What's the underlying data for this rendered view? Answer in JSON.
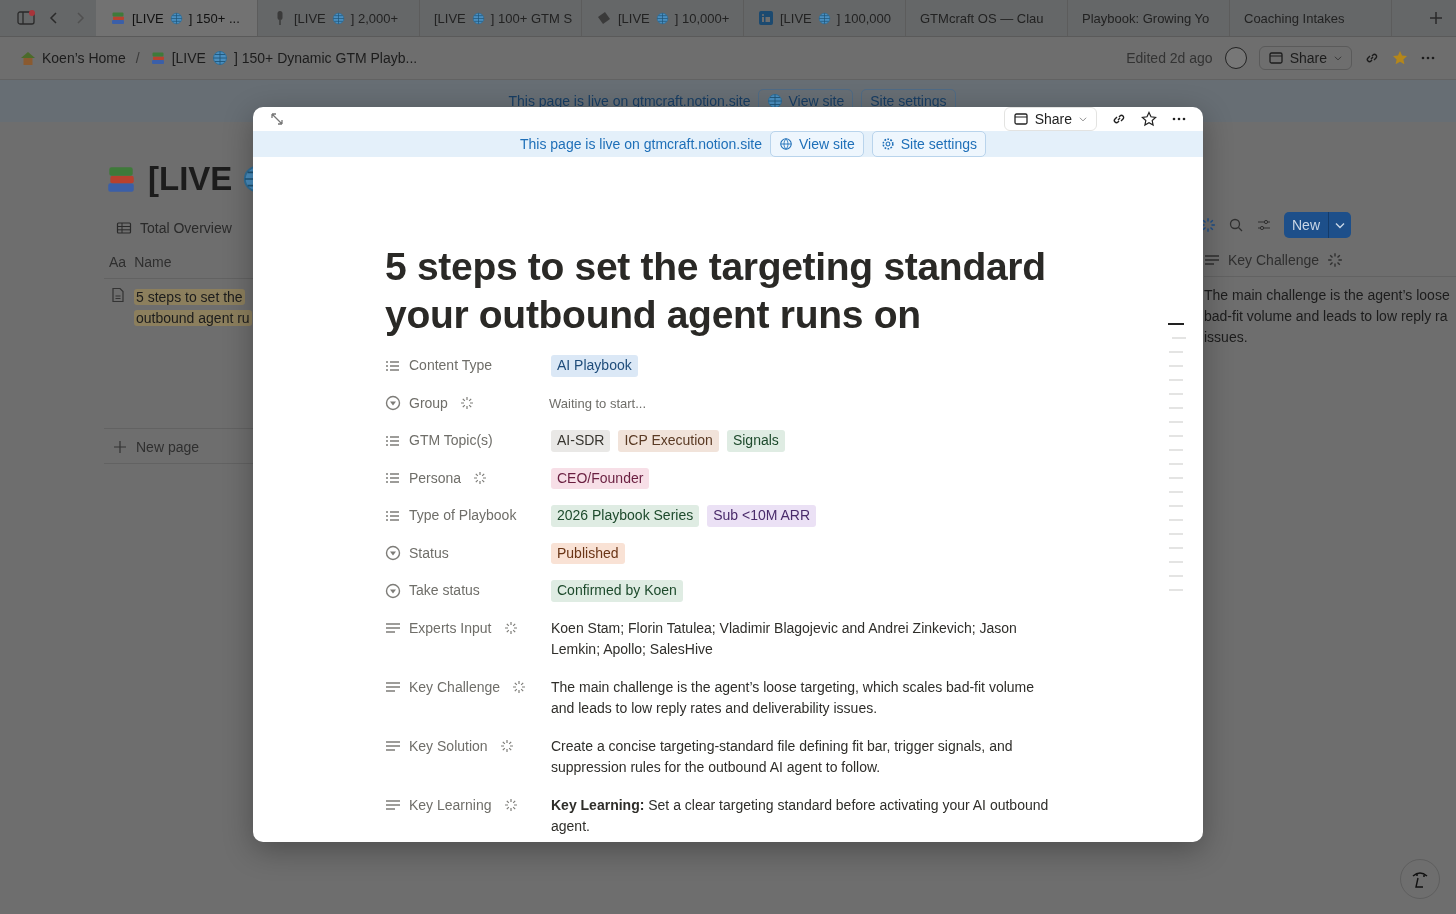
{
  "browser_tabs": [
    {
      "kind": "live",
      "prefix": "[LIVE",
      "suffix": "] 150+ ...",
      "selected": true
    },
    {
      "kind": "live",
      "prefix": "[LIVE",
      "suffix": "] 2,000+",
      "selected": false
    },
    {
      "kind": "live",
      "prefix": "[LIVE",
      "suffix": "] 100+ GTM S",
      "selected": false
    },
    {
      "kind": "live",
      "prefix": "[LIVE",
      "suffix": "] 10,000+",
      "selected": false
    },
    {
      "kind": "live",
      "prefix": "[LIVE",
      "suffix": "] 100,000",
      "selected": false
    },
    {
      "kind": "plain",
      "label": "GTMcraft OS — Clau",
      "selected": false
    },
    {
      "kind": "plain",
      "label": "Playbook: Growing Yo",
      "selected": false
    },
    {
      "kind": "plain",
      "label": "Coaching Intakes",
      "selected": false
    }
  ],
  "breadcrumb": {
    "home": "Koen’s Home",
    "separator": "/",
    "page_prefix": "[LIVE",
    "page_suffix": "] 150+ Dynamic GTM Playb...",
    "edited": "Edited 2d ago",
    "share": "Share"
  },
  "back_banner": {
    "text": "This page is live on gtmcraft.notion.site",
    "view": "View site",
    "settings": "Site settings"
  },
  "database": {
    "title": "[LIVE",
    "view": "Total Overview",
    "name_icon": "Aa",
    "name_header": "Name",
    "row_lines": [
      "5 steps to set the",
      "outbound agent ru"
    ],
    "new_page": "New page",
    "new_button": "New",
    "column_header": "Key Challenge",
    "column_lines": [
      "The main challenge is the agent’s loose",
      "bad-fit volume and leads to low reply ra",
      "issues."
    ]
  },
  "modal": {
    "share": "Share",
    "banner": {
      "text": "This page is live on gtmcraft.notion.site",
      "view": "View site",
      "settings": "Site settings"
    },
    "title": "5 steps to set the targeting standard your outbound agent runs on",
    "properties": [
      {
        "kind": "multi_select",
        "label": "Content Type",
        "ai": false,
        "tags": [
          {
            "text": "AI Playbook",
            "color": "#dbe8f6"
          }
        ]
      },
      {
        "kind": "select",
        "label": "Group",
        "ai": true,
        "placeholder": "Waiting to start..."
      },
      {
        "kind": "multi_select",
        "label": "GTM Topic(s)",
        "ai": false,
        "tags": [
          {
            "text": "AI-SDR",
            "color": "#e9e8e6"
          },
          {
            "text": "ICP Execution",
            "color": "#f1e3da"
          },
          {
            "text": "Signals",
            "color": "#dfece3"
          }
        ]
      },
      {
        "kind": "multi_select",
        "label": "Persona",
        "ai": true,
        "tags": [
          {
            "text": "CEO/Founder",
            "color": "#f7dfe7"
          }
        ]
      },
      {
        "kind": "multi_select",
        "label": "Type of Playbook",
        "ai": false,
        "tags": [
          {
            "text": "2026 Playbook Series",
            "color": "#dfece3"
          },
          {
            "text": "Sub <10M ARR",
            "color": "#ebe1f5"
          }
        ]
      },
      {
        "kind": "select",
        "label": "Status",
        "ai": false,
        "tags": [
          {
            "text": "Published",
            "color": "#f9e2d5"
          }
        ]
      },
      {
        "kind": "select",
        "label": "Take status",
        "ai": false,
        "tags": [
          {
            "text": "Confirmed by Koen",
            "color": "#dfece3"
          }
        ]
      },
      {
        "kind": "text",
        "label": "Experts Input",
        "ai": true,
        "text": "Koen Stam; Florin Tatulea; Vladimir Blagojevic and Andrei Zinkevich; Jason Lemkin; Apollo; SalesHive"
      },
      {
        "kind": "text",
        "label": "Key Challenge",
        "ai": true,
        "text": "The main challenge is the agent’s loose targeting, which scales bad-fit volume and leads to low reply rates and deliverability issues."
      },
      {
        "kind": "text",
        "label": "Key Solution",
        "ai": true,
        "text": "Create a concise targeting-standard file defining fit bar, trigger signals, and suppression rules for the outbound AI agent to follow."
      },
      {
        "kind": "text",
        "label": "Key Learning",
        "ai": true,
        "text": "**Key Learning:** Set a clear targeting standard before activating your AI outbound agent."
      }
    ]
  }
}
